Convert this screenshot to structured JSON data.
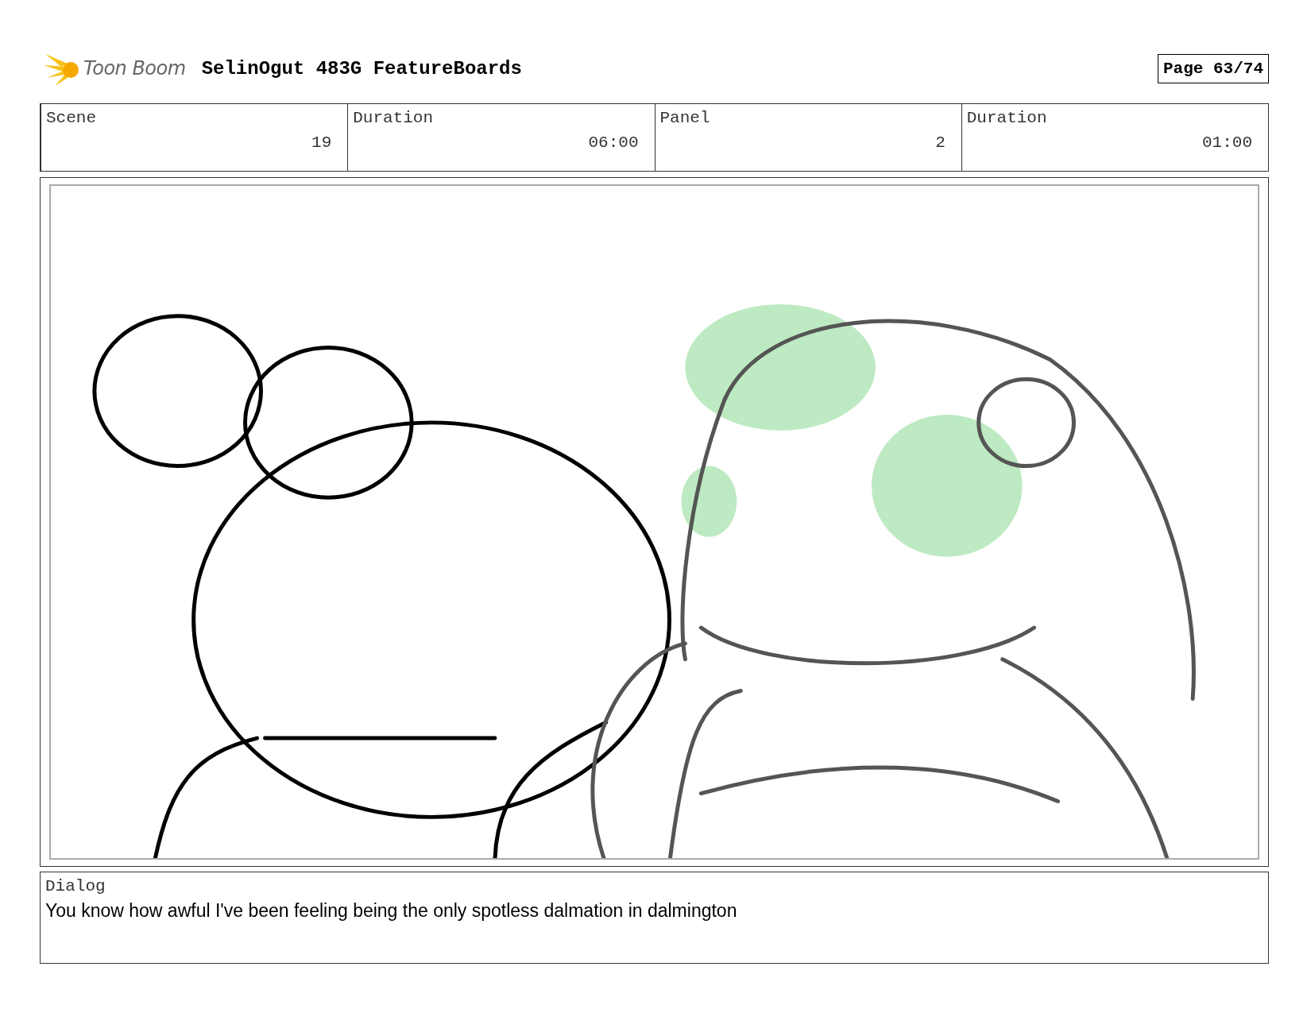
{
  "header": {
    "logo_text": "Toon Boom",
    "title": "SelinOgut 483G FeatureBoards",
    "page": "Page 63/74"
  },
  "info": [
    {
      "label": "Scene",
      "value": "19"
    },
    {
      "label": "Duration",
      "value": "06:00"
    },
    {
      "label": "Panel",
      "value": "2"
    },
    {
      "label": "Duration",
      "value": "01:00"
    }
  ],
  "panel": {
    "kind": "sketch"
  },
  "dialog": {
    "label": "Dialog",
    "text": "You know how awful I've been feeling being the only spotless dalmation in dalmington"
  }
}
